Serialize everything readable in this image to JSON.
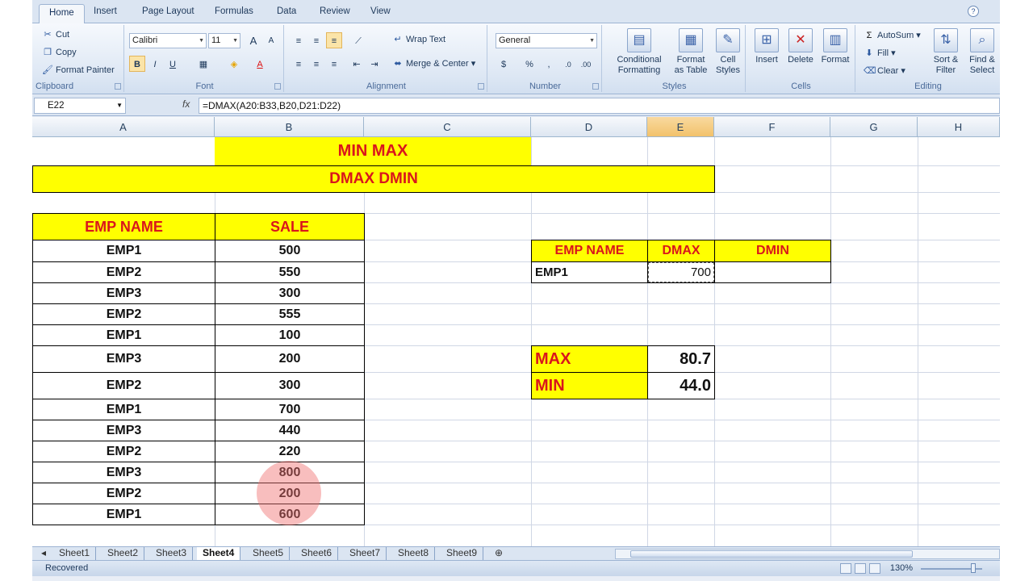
{
  "ribbon_tabs": [
    "Home",
    "Insert",
    "Page Layout",
    "Formulas",
    "Data",
    "Review",
    "View"
  ],
  "clipboard": {
    "cut": "Cut",
    "copy": "Copy",
    "format_painter": "Format Painter",
    "label": "Clipboard"
  },
  "font": {
    "name": "Calibri",
    "size": "11",
    "label": "Font",
    "bold": "B",
    "italic": "I",
    "underline": "U",
    "grow": "A",
    "shrink": "A"
  },
  "alignment": {
    "wrap": "Wrap Text",
    "merge": "Merge & Center",
    "label": "Alignment"
  },
  "number": {
    "format": "General",
    "currency": "$",
    "percent": "%",
    "comma": ",",
    "label": "Number"
  },
  "styles": {
    "conditional": "Conditional\nFormatting",
    "table": "Format\nas Table",
    "cell": "Cell\nStyles",
    "label": "Styles"
  },
  "cells": {
    "insert": "Insert",
    "delete": "Delete",
    "format": "Format",
    "label": "Cells"
  },
  "editing": {
    "autosum": "AutoSum",
    "fill": "Fill",
    "clear": "Clear",
    "sort": "Sort &\nFilter",
    "find": "Find &\nSelect",
    "label": "Editing"
  },
  "name_box": "E22",
  "formula": "=DMAX(A20:B33,B20,D21:D22)",
  "columns": [
    "A",
    "B",
    "C",
    "D",
    "E",
    "F",
    "G",
    "H"
  ],
  "selected_column": "E",
  "title1": "MIN MAX",
  "title2": "DMAX DMIN",
  "table_headers": {
    "name": "EMP NAME",
    "sale": "SALE"
  },
  "rows": [
    {
      "name": "EMP1",
      "sale": "500"
    },
    {
      "name": "EMP2",
      "sale": "550"
    },
    {
      "name": "EMP3",
      "sale": "300"
    },
    {
      "name": "EMP2",
      "sale": "555"
    },
    {
      "name": "EMP1",
      "sale": "100"
    },
    {
      "name": "EMP3",
      "sale": "200"
    },
    {
      "name": "EMP2",
      "sale": "300"
    },
    {
      "name": "EMP1",
      "sale": "700"
    },
    {
      "name": "EMP3",
      "sale": "440"
    },
    {
      "name": "EMP2",
      "sale": "220"
    },
    {
      "name": "EMP3",
      "sale": "800"
    },
    {
      "name": "EMP2",
      "sale": "200"
    },
    {
      "name": "EMP1",
      "sale": "600"
    }
  ],
  "criteria": {
    "h_name": "EMP NAME",
    "h_dmax": "DMAX",
    "h_dmin": "DMIN",
    "name": "EMP1",
    "dmax": "700",
    "dmin": ""
  },
  "stats": {
    "max_label": "MAX",
    "max_value": "80.7",
    "min_label": "MIN",
    "min_value": "44.0"
  },
  "sheets": [
    "Sheet1",
    "Sheet2",
    "Sheet3",
    "Sheet4",
    "Sheet5",
    "Sheet6",
    "Sheet7",
    "Sheet8",
    "Sheet9"
  ],
  "active_sheet": "Sheet4",
  "status": "Recovered",
  "zoom": "130%",
  "colors": {
    "highlight": "#ffff00",
    "header_text": "#d9161c"
  }
}
